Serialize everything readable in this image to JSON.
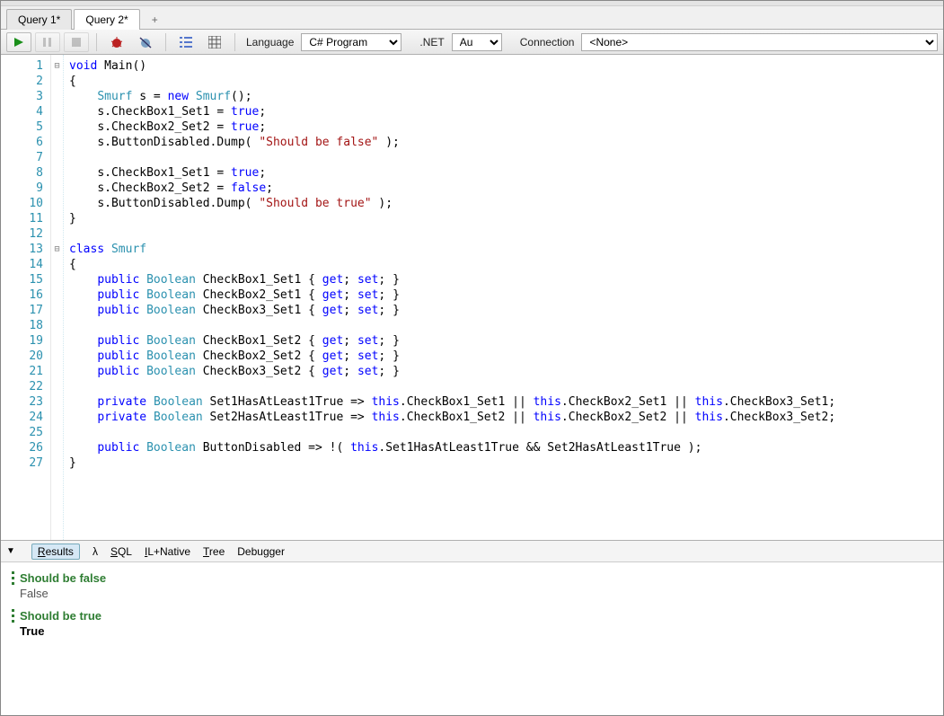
{
  "tabs": {
    "q1": "Query 1*",
    "q2": "Query 2*",
    "plus": "+"
  },
  "toolbar": {
    "language_label": "Language",
    "language_value": "C# Program",
    "net_label": ".NET",
    "net_value": "Auto",
    "connection_label": "Connection",
    "connection_value": "<None>"
  },
  "gutter": [
    "1",
    "2",
    "3",
    "4",
    "5",
    "6",
    "7",
    "8",
    "9",
    "10",
    "11",
    "12",
    "13",
    "14",
    "15",
    "16",
    "17",
    "18",
    "19",
    "20",
    "21",
    "22",
    "23",
    "24",
    "25",
    "26",
    "27"
  ],
  "fold": [
    "⊟",
    "",
    "",
    "",
    "",
    "",
    "",
    "",
    "",
    "",
    "",
    "",
    "⊟",
    "",
    "",
    "",
    "",
    "",
    "",
    "",
    "",
    "",
    "",
    "",
    "",
    "",
    ""
  ],
  "code": {
    "l1": {
      "kw1": "void",
      "pln1": " Main()"
    },
    "l2": "{",
    "l3": {
      "indent": "    ",
      "type": "Smurf",
      "mid": " s = ",
      "kw": "new",
      "ctor": " Smurf",
      "tail": "();"
    },
    "l4": {
      "indent": "    ",
      "pln": "s.CheckBox1_Set1 = ",
      "kw": "true",
      "tail": ";"
    },
    "l5": {
      "indent": "    ",
      "pln": "s.CheckBox2_Set2 = ",
      "kw": "true",
      "tail": ";"
    },
    "l6": {
      "indent": "    ",
      "pln": "s.ButtonDisabled.Dump( ",
      "str": "\"Should be false\"",
      "tail": " );"
    },
    "l7": "",
    "l8": {
      "indent": "    ",
      "pln": "s.CheckBox1_Set1 = ",
      "kw": "true",
      "tail": ";"
    },
    "l9": {
      "indent": "    ",
      "pln": "s.CheckBox2_Set2 = ",
      "kw": "false",
      "tail": ";"
    },
    "l10": {
      "indent": "    ",
      "pln": "s.ButtonDisabled.Dump( ",
      "str": "\"Should be true\"",
      "tail": " );"
    },
    "l11": "}",
    "l12": "",
    "l13": {
      "kw": "class",
      "type": " Smurf"
    },
    "l14": "{",
    "l15": {
      "indent": "    ",
      "kw1": "public ",
      "type": "Boolean",
      "name": " CheckBox1_Set1 { ",
      "kw2": "get",
      "sep": "; ",
      "kw3": "set",
      "tail": "; }"
    },
    "l16": {
      "indent": "    ",
      "kw1": "public ",
      "type": "Boolean",
      "name": " CheckBox2_Set1 { ",
      "kw2": "get",
      "sep": "; ",
      "kw3": "set",
      "tail": "; }"
    },
    "l17": {
      "indent": "    ",
      "kw1": "public ",
      "type": "Boolean",
      "name": " CheckBox3_Set1 { ",
      "kw2": "get",
      "sep": "; ",
      "kw3": "set",
      "tail": "; }"
    },
    "l18": "",
    "l19": {
      "indent": "    ",
      "kw1": "public ",
      "type": "Boolean",
      "name": " CheckBox1_Set2 { ",
      "kw2": "get",
      "sep": "; ",
      "kw3": "set",
      "tail": "; }"
    },
    "l20": {
      "indent": "    ",
      "kw1": "public ",
      "type": "Boolean",
      "name": " CheckBox2_Set2 { ",
      "kw2": "get",
      "sep": "; ",
      "kw3": "set",
      "tail": "; }"
    },
    "l21": {
      "indent": "    ",
      "kw1": "public ",
      "type": "Boolean",
      "name": " CheckBox3_Set2 { ",
      "kw2": "get",
      "sep": "; ",
      "kw3": "set",
      "tail": "; }"
    },
    "l22": "",
    "l23": {
      "indent": "    ",
      "kw1": "private ",
      "type": "Boolean",
      "name": " Set1HasAtLeast1True => ",
      "kw2": "this",
      "a": ".CheckBox1_Set1 || ",
      "kw3": "this",
      "b": ".CheckBox2_Set1 || ",
      "kw4": "this",
      "c": ".CheckBox3_Set1;"
    },
    "l24": {
      "indent": "    ",
      "kw1": "private ",
      "type": "Boolean",
      "name": " Set2HasAtLeast1True => ",
      "kw2": "this",
      "a": ".CheckBox1_Set2 || ",
      "kw3": "this",
      "b": ".CheckBox2_Set2 || ",
      "kw4": "this",
      "c": ".CheckBox3_Set2;"
    },
    "l25": "",
    "l26": {
      "indent": "    ",
      "kw1": "public ",
      "type": "Boolean",
      "name": " ButtonDisabled => !( ",
      "kw2": "this",
      "a": ".Set1HasAtLeast1True && Set2HasAtLeast1True );"
    },
    "l27": "}"
  },
  "result_tabs": {
    "results": "Results",
    "lambda": "λ",
    "sql": "SQL",
    "il": "IL+Native",
    "tree": "Tree",
    "debugger": "Debugger"
  },
  "results": {
    "h1": "Should be false",
    "v1": "False",
    "h2": "Should be true",
    "v2": "True"
  }
}
